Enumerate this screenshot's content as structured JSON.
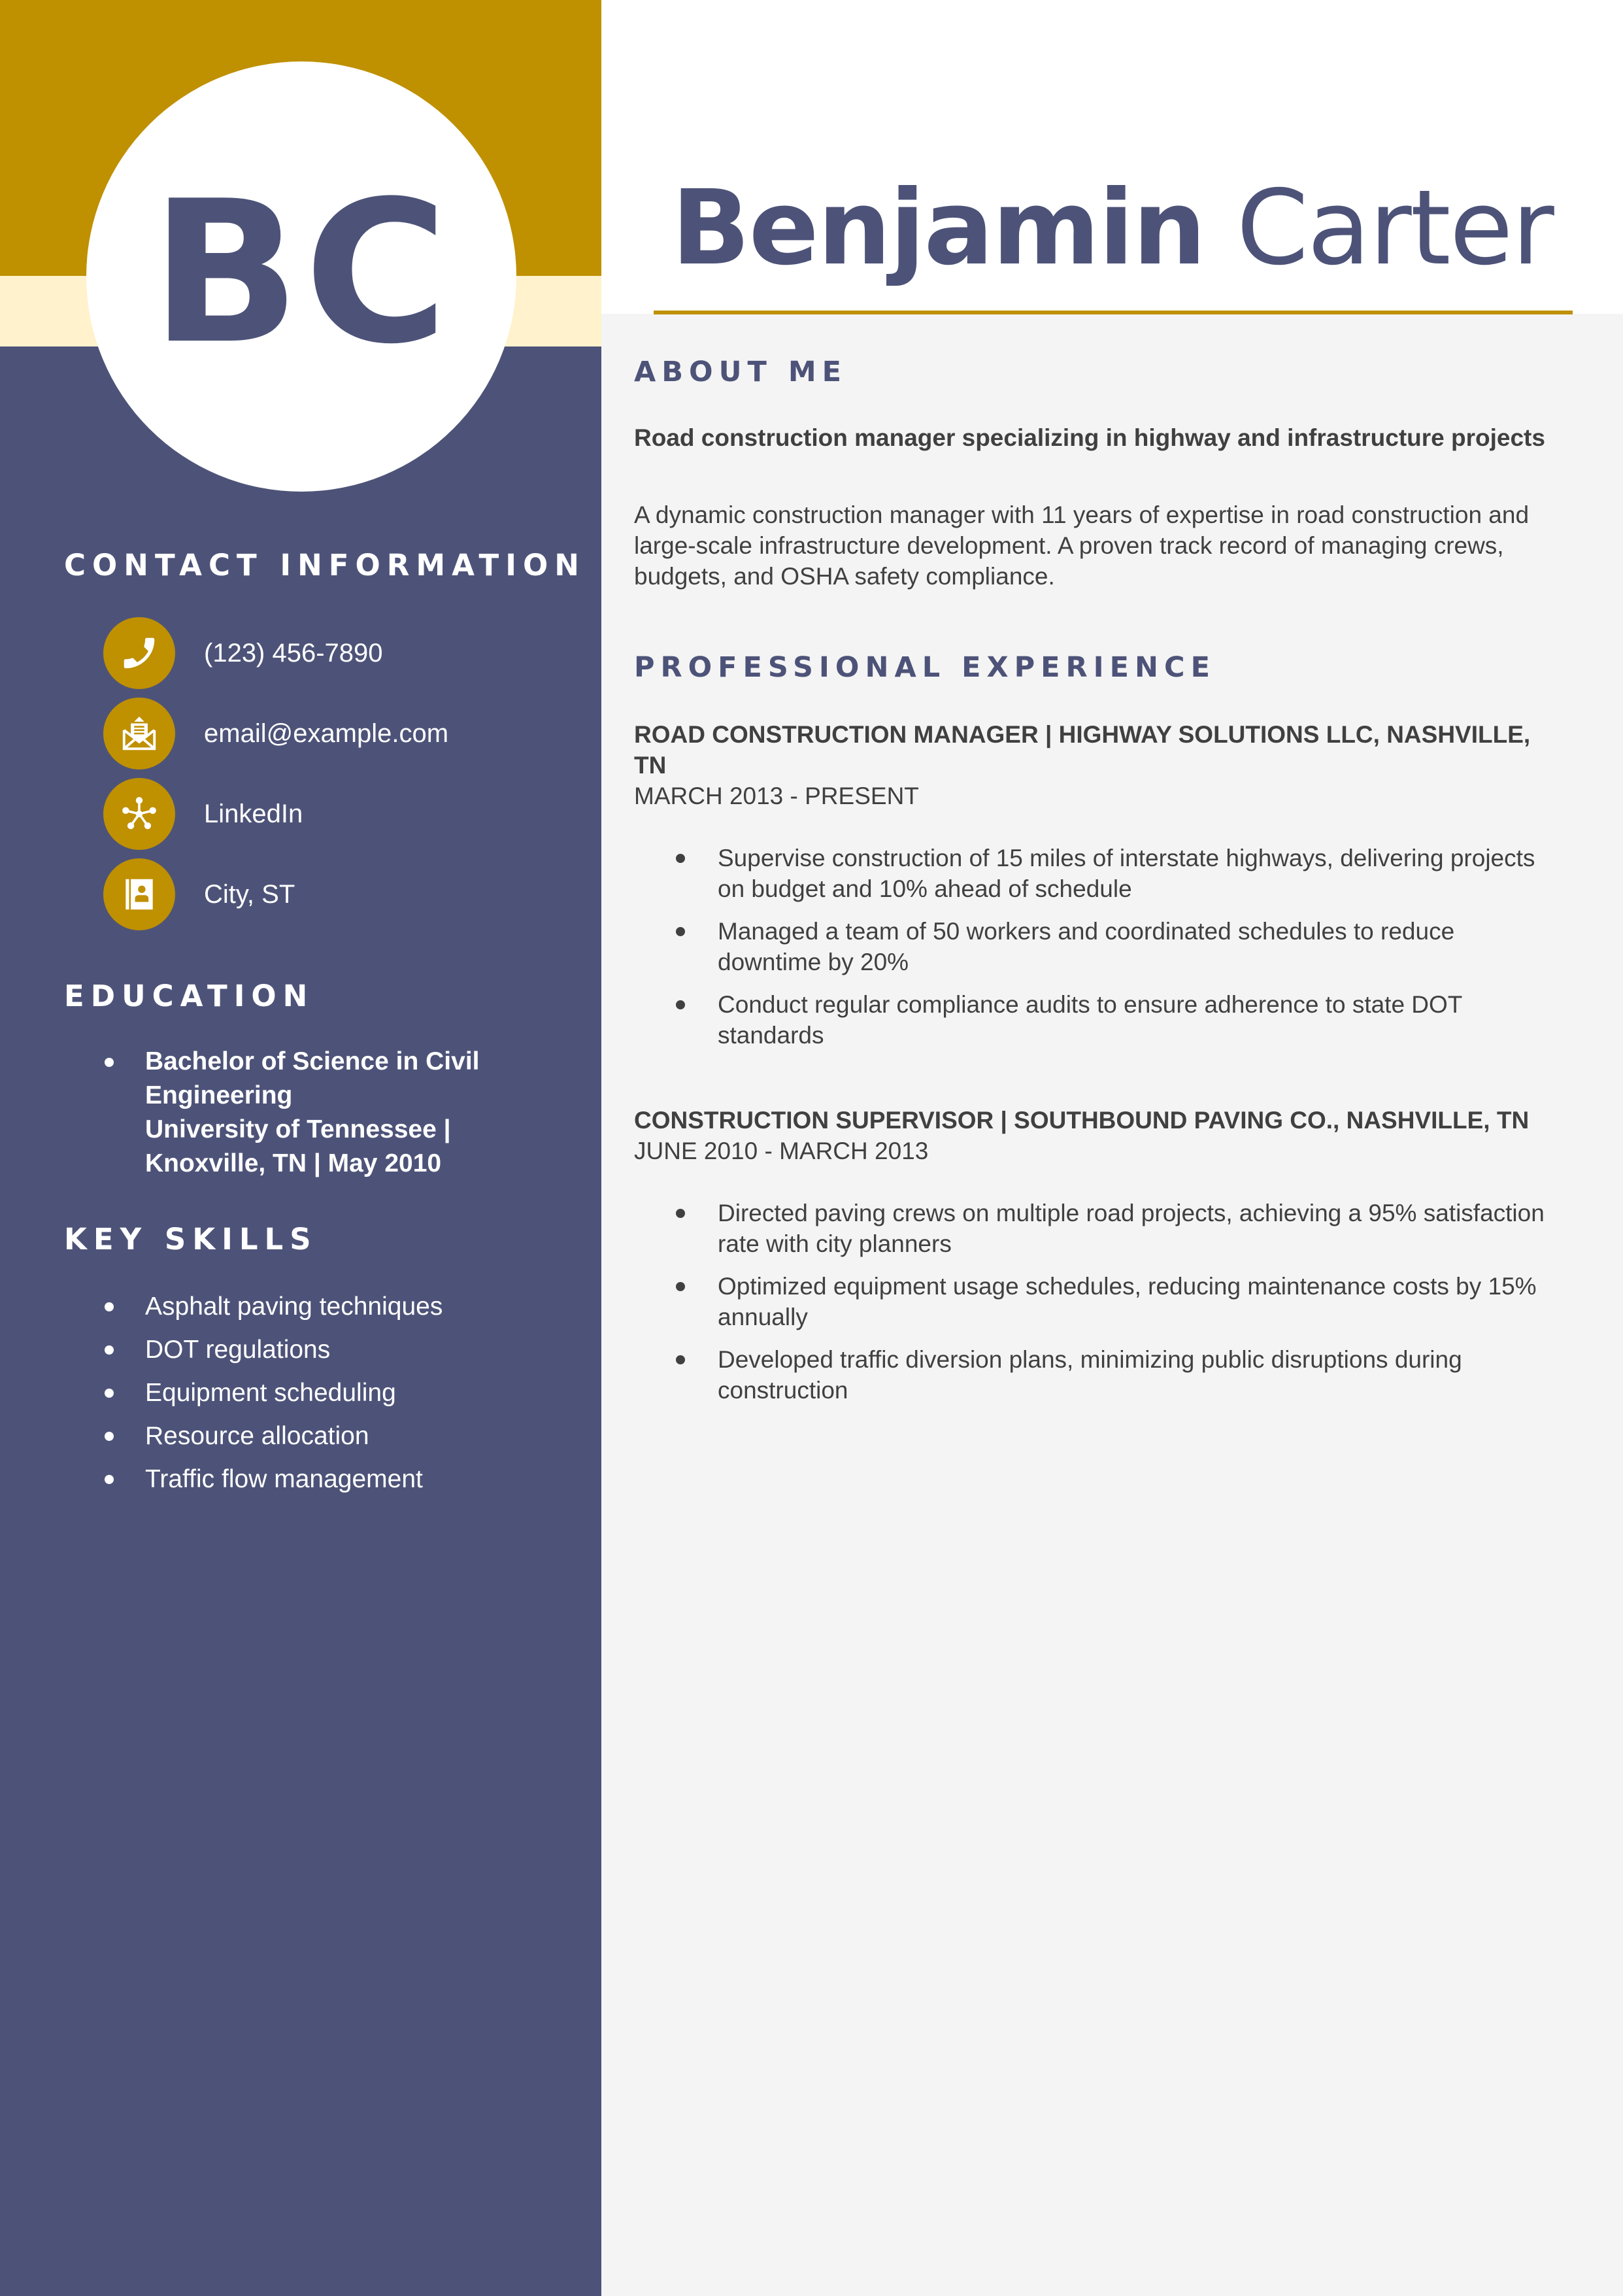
{
  "header": {
    "monogram": "BC",
    "first_name": "Benjamin",
    "last_name": "Carter"
  },
  "colors": {
    "navy": "#4d5378",
    "gold": "#bf9000",
    "cream": "#fff2cc",
    "text": "#404040",
    "page": "#f4f4f4"
  },
  "sidebar": {
    "contact": {
      "heading": "CONTACT INFORMATION",
      "items": [
        {
          "icon": "phone-icon",
          "text": "(123) 456-7890"
        },
        {
          "icon": "envelope-icon",
          "text": "email@example.com"
        },
        {
          "icon": "network-icon",
          "text": "LinkedIn"
        },
        {
          "icon": "address-book-icon",
          "text": "City, ST"
        }
      ]
    },
    "education": {
      "heading": "EDUCATION",
      "items": [
        {
          "degree": "Bachelor of Science in Civil Engineering",
          "school": "University of Tennessee | Knoxville, TN | May 2010"
        }
      ]
    },
    "skills": {
      "heading": "KEY SKILLS",
      "items": [
        "Asphalt paving techniques",
        "DOT regulations",
        "Equipment scheduling",
        "Resource allocation",
        "Traffic flow management"
      ]
    }
  },
  "main": {
    "about": {
      "heading": "ABOUT ME",
      "title": "Road construction manager specializing in highway and infrastructure projects",
      "body": "A dynamic construction manager with 11 years of expertise in road construction and large-scale infrastructure development. A proven track record of managing crews, budgets, and OSHA safety compliance."
    },
    "experience": {
      "heading": "PROFESSIONAL EXPERIENCE",
      "jobs": [
        {
          "title": "ROAD CONSTRUCTION MANAGER | HIGHWAY SOLUTIONS LLC, NASHVILLE, TN",
          "dates": "MARCH 2013 - PRESENT",
          "bullets": [
            "Supervise construction of 15 miles of interstate highways, delivering projects on budget and 10% ahead of schedule",
            "Managed a team of 50 workers and coordinated schedules to reduce downtime by 20%",
            "Conduct regular compliance audits to ensure adherence to state DOT standards"
          ]
        },
        {
          "title": "CONSTRUCTION SUPERVISOR | SOUTHBOUND PAVING CO., NASHVILLE, TN",
          "dates": "JUNE 2010 - MARCH 2013",
          "bullets": [
            "Directed paving crews on multiple road projects, achieving a 95% satisfaction rate with city planners",
            "Optimized equipment usage schedules, reducing maintenance costs by 15% annually",
            "Developed traffic diversion plans, minimizing public disruptions during construction"
          ]
        }
      ]
    }
  }
}
